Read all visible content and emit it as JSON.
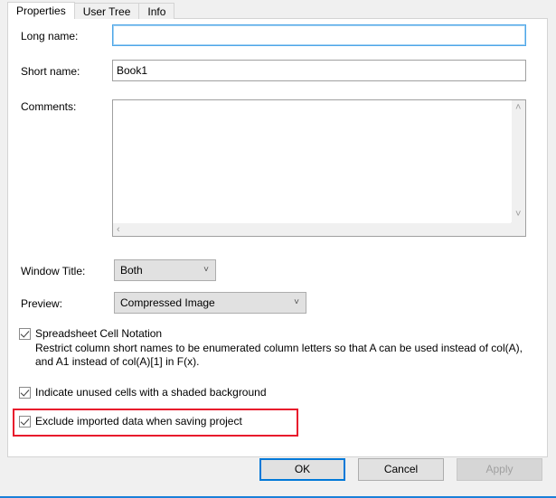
{
  "dialog": {
    "tabs": [
      {
        "label": "Properties",
        "selected": true
      },
      {
        "label": "User Tree",
        "selected": false
      },
      {
        "label": "Info",
        "selected": false
      }
    ],
    "fields": {
      "long_name_label": "Long name:",
      "long_name_value": "",
      "short_name_label": "Short name:",
      "short_name_value": "Book1",
      "comments_label": "Comments:",
      "comments_value": ""
    },
    "combos": {
      "window_title_label": "Window Title:",
      "window_title_value": "Both",
      "preview_label": "Preview:",
      "preview_value": "Compressed Image"
    },
    "checkboxes": {
      "spreadsheet_cell_notation": {
        "label": "Spreadsheet Cell Notation",
        "checked": true,
        "description": "Restrict column short names to be enumerated column letters so that A can be used instead of col(A), and A1 instead of col(A)[1] in F(x)."
      },
      "indicate_unused_cells": {
        "label": "Indicate unused cells with a shaded background",
        "checked": true
      },
      "exclude_imported_data": {
        "label": "Exclude imported data when saving project",
        "checked": true,
        "highlighted": true
      }
    },
    "buttons": {
      "ok": "OK",
      "cancel": "Cancel",
      "apply": "Apply",
      "apply_disabled": true
    },
    "colors": {
      "accent": "#0078d7",
      "highlight": "#e8192c",
      "dialog_bg": "#f0f0f0",
      "panel_bg": "#ffffff"
    },
    "icons": {
      "scroll_up": "˄",
      "scroll_down": "˅",
      "scroll_left": "‹",
      "scroll_right": "›",
      "combo_chevron": "˅"
    }
  }
}
